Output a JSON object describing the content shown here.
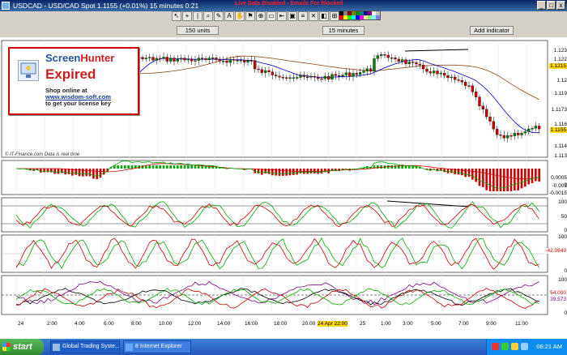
{
  "window": {
    "title": "USDCAD - USD/CAD Spot    1.1155 (+0.01%)    15 minutes  0:21",
    "warning": "Live Data Disabled - Emails For Blocked"
  },
  "toolbar": {
    "buttons": [
      "↖",
      "+",
      "|",
      "⌕",
      "✎",
      "A",
      "✋",
      "⚑",
      "⊕",
      "▭",
      "⇤",
      "▣",
      "≡",
      "✕",
      "◧",
      "⊞",
      "⊟",
      "⊠"
    ]
  },
  "palette": [
    "#000000",
    "#808080",
    "#800000",
    "#808000",
    "#008000",
    "#008080",
    "#000080",
    "#800080",
    "#ffffff",
    "#c0c0c0",
    "#ff0000",
    "#ffff00",
    "#00ff00",
    "#00ffff",
    "#0000ff",
    "#ff00ff",
    "#ffff80",
    "#80ff80",
    "#80ffff",
    "#8080ff"
  ],
  "window_buttons": {
    "minimize": "_",
    "maximize": "□",
    "close": "x"
  },
  "chart_controls": {
    "bars": "150 units",
    "interval": "15 minutes",
    "add_indicator": "Add indicator"
  },
  "overlay": {
    "brand_screen": "Screen",
    "brand_hunter": "Hunter",
    "status": "Expired",
    "line1": "Shop online at",
    "url": "www.wisdom-soft.com",
    "line3": "to get your license key"
  },
  "credit": "© IT-Finance.com  Data is real time",
  "price_axis": {
    "labels": [
      "1.123",
      "1.122",
      "1.12",
      "1.119",
      "1.1173",
      "1.116",
      "1.115",
      "1.114",
      "1.113"
    ],
    "current": "1.1155",
    "marker": "1.1215"
  },
  "macd_axis": [
    "0.0005",
    "0",
    "-0.001",
    "-0.0015"
  ],
  "stoch_axis": [
    "100",
    "50",
    "0"
  ],
  "rsi_axis": [
    "100",
    "-42.0849",
    "0"
  ],
  "dmi_axis": [
    "100",
    "54.000",
    "39.573",
    "0"
  ],
  "time_axis": [
    "24",
    "2:00",
    "4:00",
    "6:00",
    "8:00",
    "10:00",
    "12:00",
    "14:00",
    "16:00",
    "18:00",
    "20:00",
    "24 Apr 22:00",
    "25",
    "1:00",
    "3:00",
    "5:00",
    "7:00",
    "9:00",
    "11:00"
  ],
  "taskbar": {
    "start": "start",
    "tasks": [
      "Global Trading Syste...",
      "8 Internet Explorer"
    ],
    "clock": "06:21 AM"
  },
  "colors": {
    "title_bar": "#0a246a",
    "bull_candle": "#008000",
    "bear_candle": "#cc0000",
    "ma_fast": "#0000cc",
    "ma_slow": "#8b4513",
    "osc_green": "#00aa00",
    "osc_red": "#cc0000",
    "highlight": "#ffd700"
  }
}
